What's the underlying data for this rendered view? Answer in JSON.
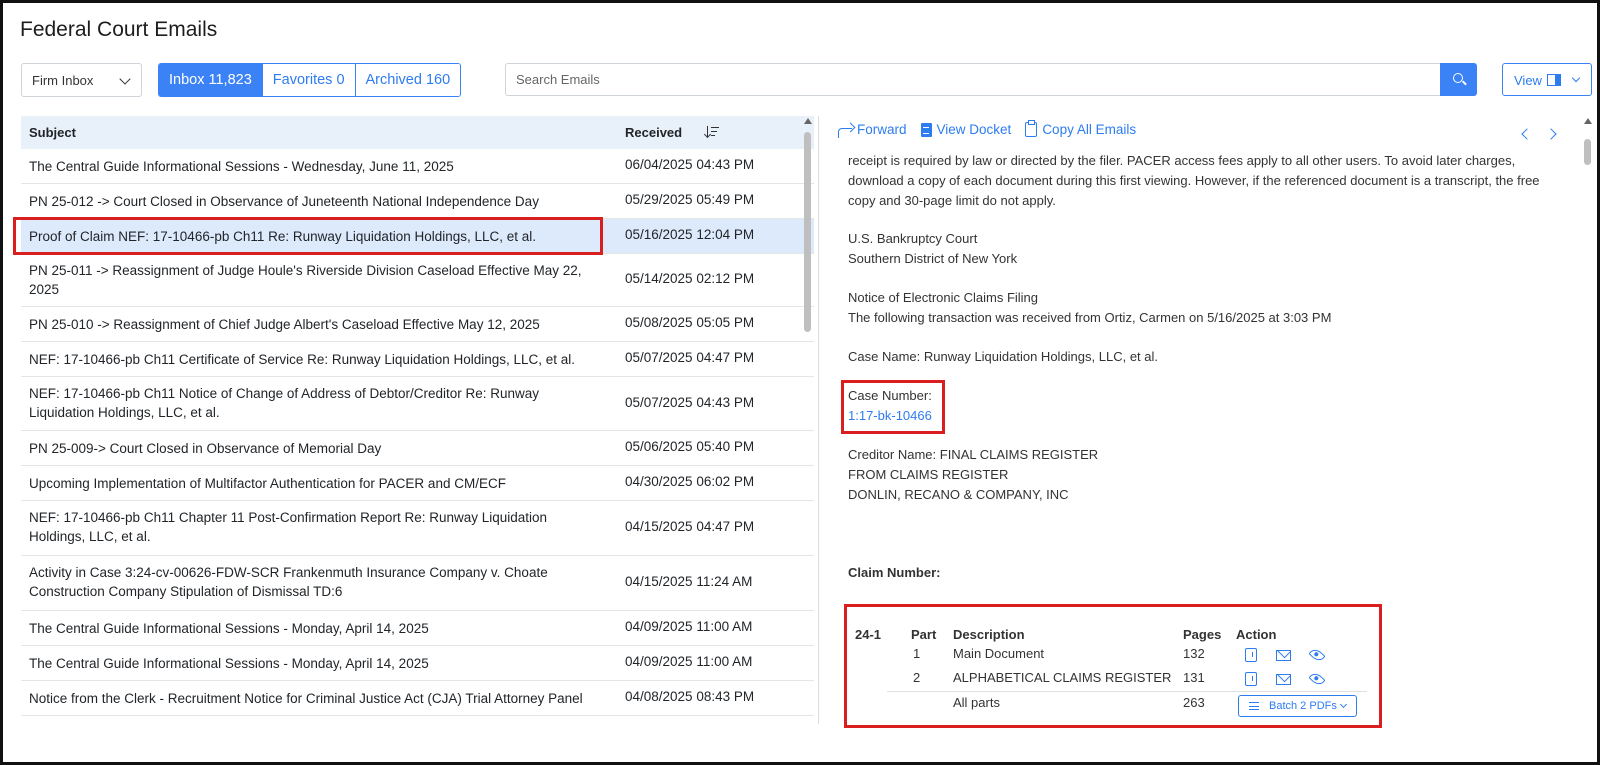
{
  "app": {
    "title": "Federal Court Emails"
  },
  "toolbar": {
    "inbox_select": "Firm Inbox",
    "tabs": [
      {
        "label": "Inbox 11,823",
        "active": true
      },
      {
        "label": "Favorites 0",
        "active": false
      },
      {
        "label": "Archived 160",
        "active": false
      }
    ],
    "search_placeholder": "Search Emails",
    "view_label": "View"
  },
  "list": {
    "col_subject": "Subject",
    "col_received": "Received",
    "rows": [
      {
        "subject": "The Central Guide Informational Sessions - Wednesday, June 11, 2025",
        "received": "06/04/2025 04:43 PM"
      },
      {
        "subject": "PN 25-012 -> Court Closed in Observance of Juneteenth National Independence Day",
        "received": "05/29/2025 05:49 PM"
      },
      {
        "subject": "Proof of Claim NEF: 17-10466-pb Ch11 Re: Runway Liquidation Holdings, LLC, et al.",
        "received": "05/16/2025 12:04 PM",
        "selected": true
      },
      {
        "subject": "PN 25-011 -> Reassignment of Judge Houle's Riverside Division Caseload Effective May 22, 2025",
        "received": "05/14/2025 02:12 PM"
      },
      {
        "subject": "PN 25-010 -> Reassignment of Chief Judge Albert's Caseload Effective May 12, 2025",
        "received": "05/08/2025 05:05 PM"
      },
      {
        "subject": "NEF: 17-10466-pb Ch11 Certificate of Service Re: Runway Liquidation Holdings, LLC, et al.",
        "received": "05/07/2025 04:47 PM"
      },
      {
        "subject": "NEF: 17-10466-pb Ch11 Notice of Change of Address of Debtor/Creditor Re: Runway Liquidation Holdings, LLC, et al.",
        "received": "05/07/2025 04:43 PM"
      },
      {
        "subject": "PN 25-009-> Court Closed in Observance of Memorial Day",
        "received": "05/06/2025 05:40 PM"
      },
      {
        "subject": "Upcoming Implementation of Multifactor Authentication for PACER and CM/ECF",
        "received": "04/30/2025 06:02 PM"
      },
      {
        "subject": "NEF: 17-10466-pb Ch11 Chapter 11 Post-Confirmation Report Re: Runway Liquidation Holdings, LLC, et al.",
        "received": "04/15/2025 04:47 PM"
      },
      {
        "subject": "Activity in Case 3:24-cv-00626-FDW-SCR Frankenmuth Insurance Company v. Choate Construction Company Stipulation of Dismissal TD:6",
        "received": "04/15/2025 11:24 AM"
      },
      {
        "subject": "The Central Guide Informational Sessions - Monday, April 14, 2025",
        "received": "04/09/2025 11:00 AM"
      },
      {
        "subject": "The Central Guide Informational Sessions - Monday, April 14, 2025",
        "received": "04/09/2025 11:00 AM"
      },
      {
        "subject": "Notice from the Clerk - Recruitment Notice for Criminal Justice Act (CJA) Trial Attorney Panel",
        "received": "04/08/2025 08:43 PM"
      }
    ]
  },
  "preview": {
    "tools": {
      "forward": "Forward",
      "view_docket": "View Docket",
      "copy_all": "Copy All Emails"
    },
    "body": {
      "p1_line1": "receipt is required by law or directed by the filer. PACER access fees apply to all other users. To avoid later charges,",
      "p1_line2": "download a copy of each document during this first viewing. However, if the referenced document is a transcript, the free",
      "p1_line3": "copy and 30-page limit do not apply.",
      "court_line1": "U.S. Bankruptcy Court",
      "court_line2": "Southern District of New York",
      "notice_title": "Notice of Electronic Claims Filing",
      "notice_text": "The following transaction was received from Ortiz, Carmen on 5/16/2025 at 3:03 PM",
      "case_name": "Case Name: Runway Liquidation Holdings, LLC, et al.",
      "case_number_label": "Case Number:",
      "case_number": "1:17-bk-10466",
      "creditor_line1": "Creditor Name: FINAL CLAIMS REGISTER",
      "creditor_line2": "FROM CLAIMS REGISTER",
      "creditor_line3": "DONLIN, RECANO & COMPANY, INC",
      "claim_number_label": "Claim Number:"
    },
    "claims": {
      "claim_id": "24-1",
      "headers": {
        "part": "Part",
        "description": "Description",
        "pages": "Pages",
        "action": "Action"
      },
      "rows": [
        {
          "part": "1",
          "description": "Main Document",
          "pages": "132"
        },
        {
          "part": "2",
          "description": "ALPHABETICAL CLAIMS REGISTER",
          "pages": "131"
        }
      ],
      "all_parts_label": "All parts",
      "all_parts_pages": "263",
      "batch_label": "Batch 2 PDFs"
    }
  },
  "colors": {
    "accent": "#3b82f6",
    "highlight": "#d81e1e",
    "selected_row": "#ddeafb"
  }
}
